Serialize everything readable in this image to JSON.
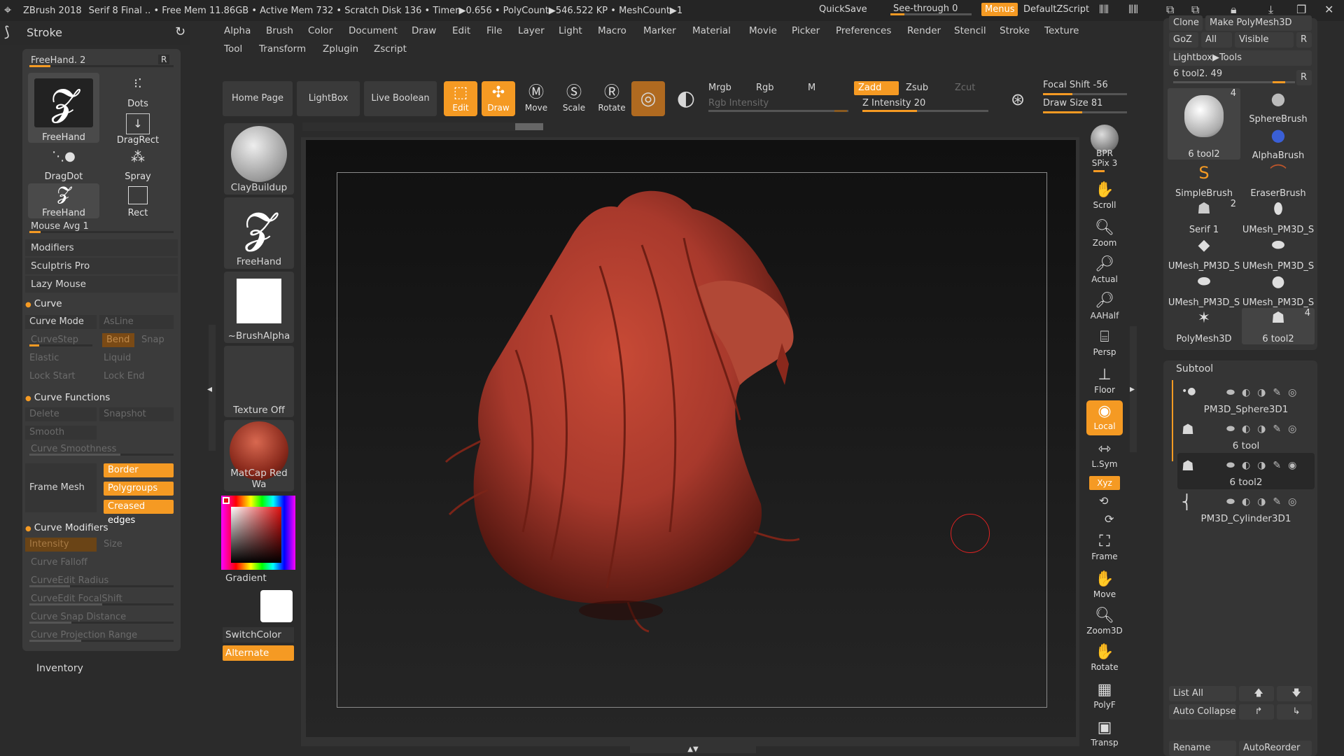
{
  "titlebar": {
    "app": "ZBrush 2018",
    "stats": "Serif 8 Final  .. • Free Mem 11.86GB • Active Mem 732 • Scratch Disk 136 • Timer▶0.656 • PolyCount▶546.522 KP  • MeshCount▶1",
    "quicksave": "QuickSave",
    "see_through": "See-through  0",
    "menus": "Menus",
    "default_zscript": "DefaultZScript"
  },
  "stroke": {
    "title": "Stroke",
    "current": "FreeHand. 2",
    "r": "R",
    "strokes": [
      "FreeHand",
      "Dots",
      "DragRect",
      "DragDot",
      "Spray",
      "FreeHand",
      "Rect"
    ],
    "mouse_avg": "Mouse Avg 1",
    "rows": [
      "Modifiers",
      "Sculptris Pro",
      "Lazy Mouse"
    ],
    "curve_section": "Curve",
    "curve_mode": "Curve Mode",
    "asline": "AsLine",
    "curve_step": "CurveStep",
    "bend": "Bend",
    "snap": "Snap",
    "elastic": "Elastic",
    "liquid": "Liquid",
    "lock_start": "Lock Start",
    "lock_end": "Lock End",
    "curve_functions": "Curve Functions",
    "delete": "Delete",
    "snapshot": "Snapshot",
    "smooth": "Smooth",
    "curve_smoothness": "Curve Smoothness",
    "frame_mesh": "Frame Mesh",
    "border": "Border",
    "polygroups": "Polygroups",
    "creased_edges": "Creased edges",
    "curve_modifiers": "Curve Modifiers",
    "intensity": "Intensity",
    "size": "Size",
    "curve_falloff": "Curve Falloff",
    "curveedit_radius": "CurveEdit Radius",
    "curveedit_focalshift": "CurveEdit FocalShift",
    "curve_snap_distance": "Curve Snap Distance",
    "curve_projection_range": "Curve Projection Range",
    "inventory": "Inventory"
  },
  "menu": {
    "row1": [
      "Alpha",
      "Brush",
      "Color",
      "Document",
      "Draw",
      "Edit",
      "File",
      "Layer",
      "Light",
      "Macro",
      "Marker",
      "Material",
      "Movie",
      "Picker",
      "Preferences",
      "Render",
      "Stencil",
      "Stroke",
      "Texture"
    ],
    "row2": [
      "Tool",
      "Transform",
      "Zplugin",
      "Zscript"
    ]
  },
  "toolbar": {
    "home_page": "Home Page",
    "lightbox": "LightBox",
    "live_boolean": "Live Boolean",
    "edit": "Edit",
    "draw": "Draw",
    "move": "Move",
    "scale": "Scale",
    "rotate": "Rotate",
    "mrgb": "Mrgb",
    "rgb": "Rgb",
    "m": "M",
    "rgb_intensity": "Rgb Intensity",
    "zadd": "Zadd",
    "zsub": "Zsub",
    "zcut": "Zcut",
    "z_intensity": "Z Intensity 20",
    "focal_shift": "Focal Shift -56",
    "draw_size": "Draw Size 81"
  },
  "materials": {
    "brush": "ClayBuildup",
    "stroke": "FreeHand",
    "alpha": "~BrushAlpha",
    "texture": "Texture Off",
    "material": "MatCap Red Wa",
    "gradient": "Gradient",
    "switch_color": "SwitchColor",
    "alternate": "Alternate"
  },
  "shelf": [
    "BPR",
    "SPix 3",
    "Scroll",
    "Zoom",
    "Actual",
    "AAHalf",
    "Persp",
    "Floor",
    "Local",
    "L.Sym",
    "Xyz",
    "Frame",
    "Move",
    "Zoom3D",
    "Rotate",
    "PolyF",
    "Transp"
  ],
  "tool": {
    "clone": "Clone",
    "make_polymesh": "Make PolyMesh3D",
    "goz": "GoZ",
    "all": "All",
    "visible": "Visible",
    "r": "R",
    "lightbox_tools": "Lightbox▶Tools",
    "current": "6 tool2. 49",
    "items": [
      {
        "name": "6 tool2",
        "count": "4"
      },
      {
        "name": "SphereBrush",
        "count": ""
      },
      {
        "name": "AlphaBrush",
        "count": ""
      },
      {
        "name": "SimpleBrush",
        "count": ""
      },
      {
        "name": "EraserBrush",
        "count": ""
      },
      {
        "name": "Serif 1",
        "count": "2"
      },
      {
        "name": "UMesh_PM3D_S",
        "count": ""
      },
      {
        "name": "UMesh_PM3D_S",
        "count": ""
      },
      {
        "name": "UMesh_PM3D_S",
        "count": ""
      },
      {
        "name": "UMesh_PM3D_S",
        "count": ""
      },
      {
        "name": "UMesh_PM3D_S",
        "count": ""
      },
      {
        "name": "PolyMesh3D",
        "count": ""
      },
      {
        "name": "6 tool2",
        "count": "4"
      }
    ]
  },
  "subtool": {
    "title": "Subtool",
    "items": [
      "PM3D_Sphere3D1",
      "6 tool",
      "6 tool2",
      "PM3D_Cylinder3D1"
    ],
    "list_all": "List All",
    "auto_collapse": "Auto Collapse",
    "rename": "Rename",
    "autoreorder": "AutoReorder"
  },
  "colors": {
    "accent": "#f59a23",
    "model": "#a8392c"
  }
}
